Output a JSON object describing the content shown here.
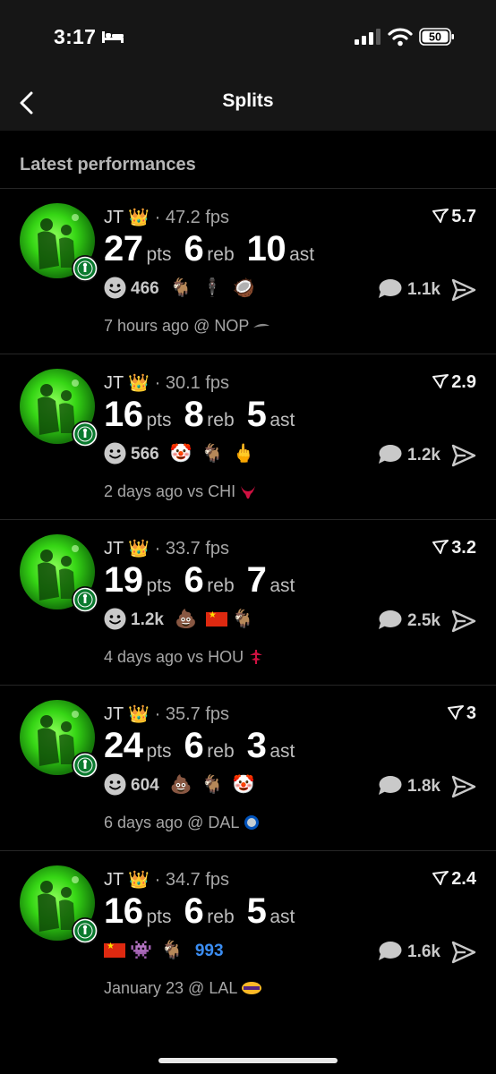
{
  "status_bar": {
    "time": "3:17",
    "battery": "50"
  },
  "nav": {
    "title": "Splits"
  },
  "section_title": "Latest performances",
  "labels": {
    "pts": "pts",
    "reb": "reb",
    "ast": "ast"
  },
  "cards": [
    {
      "player": "JT",
      "crown": "👑",
      "fps": "· 47.2 fps",
      "rating": "5.7",
      "pts": "27",
      "reb": "6",
      "ast": "10",
      "reaction_count": "466",
      "emojis": [
        "🐐",
        "🕴🏿",
        "🥥"
      ],
      "comments": "1.1k",
      "when": "7 hours ago @ NOP",
      "opponent_logo": "pelicans-logo"
    },
    {
      "player": "JT",
      "crown": "👑",
      "fps": "· 30.1 fps",
      "rating": "2.9",
      "pts": "16",
      "reb": "8",
      "ast": "5",
      "reaction_count": "566",
      "emojis": [
        "🤡",
        "🐐",
        "🖕"
      ],
      "comments": "1.2k",
      "when": "2 days ago vs CHI",
      "opponent_logo": "bulls-logo"
    },
    {
      "player": "JT",
      "crown": "👑",
      "fps": "· 33.7 fps",
      "rating": "3.2",
      "pts": "19",
      "reb": "6",
      "ast": "7",
      "reaction_count": "1.2k",
      "emojis": [
        "💩",
        "🇨🇳",
        "🐐"
      ],
      "comments": "2.5k",
      "when": "4 days ago vs HOU",
      "opponent_logo": "rockets-logo"
    },
    {
      "player": "JT",
      "crown": "👑",
      "fps": "· 35.7 fps",
      "rating": "3",
      "pts": "24",
      "reb": "6",
      "ast": "3",
      "reaction_count": "604",
      "emojis": [
        "💩",
        "🐐",
        "🤡"
      ],
      "comments": "1.8k",
      "when": "6 days ago @ DAL",
      "opponent_logo": "mavericks-logo"
    },
    {
      "player": "JT",
      "crown": "👑",
      "fps": "· 34.7 fps",
      "rating": "2.4",
      "pts": "16",
      "reb": "6",
      "ast": "5",
      "reaction_count": "993",
      "emojis": [
        "🇨🇳",
        "👾",
        "🐐"
      ],
      "comments": "1.6k",
      "when": "January 23 @ LAL",
      "opponent_logo": "lakers-logo"
    }
  ]
}
